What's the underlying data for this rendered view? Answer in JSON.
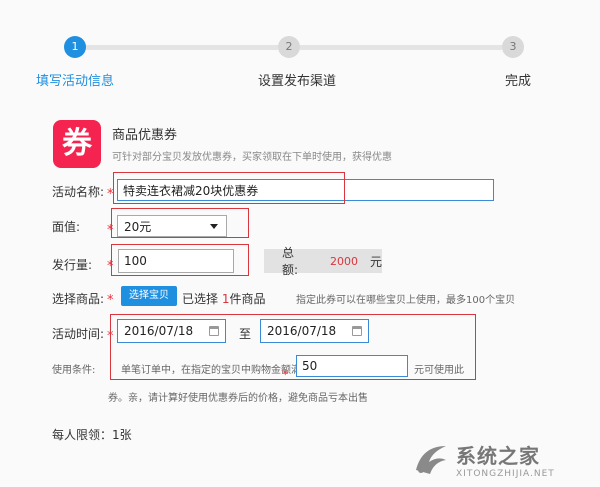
{
  "steps": [
    {
      "number": "1",
      "label": "填写活动信息"
    },
    {
      "number": "2",
      "label": "设置发布渠道"
    },
    {
      "number": "3",
      "label": "完成"
    }
  ],
  "coupon": {
    "icon_text": "券",
    "title": "商品优惠券",
    "description": "可针对部分宝贝发放优惠券，买家领取在下单时使用，获得优惠"
  },
  "form": {
    "star": "*",
    "activity_name": {
      "label": "活动名称:",
      "value": "特卖连衣裙减20块优惠券"
    },
    "face_value": {
      "label": "面值:",
      "selected": "20元"
    },
    "quantity": {
      "label": "发行量:",
      "value": "100"
    },
    "total": {
      "label": "总额:",
      "amount": "2000",
      "unit": "元"
    },
    "select_goods": {
      "label": "选择商品:",
      "button": "选择宝贝",
      "selected_prefix": "已选择",
      "selected_count": "1",
      "selected_suffix": "件商品",
      "hint": "指定此券可以在哪些宝贝上使用，最多100个宝贝"
    },
    "activity_time": {
      "label": "活动时间:",
      "start": "2016/07/18",
      "separator": "至",
      "end": "2016/07/18"
    },
    "conditions": {
      "label": "使用条件:",
      "prefix": "单笔订单中，在指定的宝贝中购物金额满",
      "value": "50",
      "suffix": "元可使用此",
      "suffix_line2": "券。亲，请计算好使用优惠券后的价格，避免商品亏本出售"
    },
    "per_person_limit": "每人限领：1张"
  },
  "watermark": {
    "text": "系统之家",
    "url": "XITONGZHIJIA.NET"
  },
  "colors": {
    "accent": "#1f8fe0",
    "coupon": "#f5234f",
    "required": "#e8303a"
  }
}
